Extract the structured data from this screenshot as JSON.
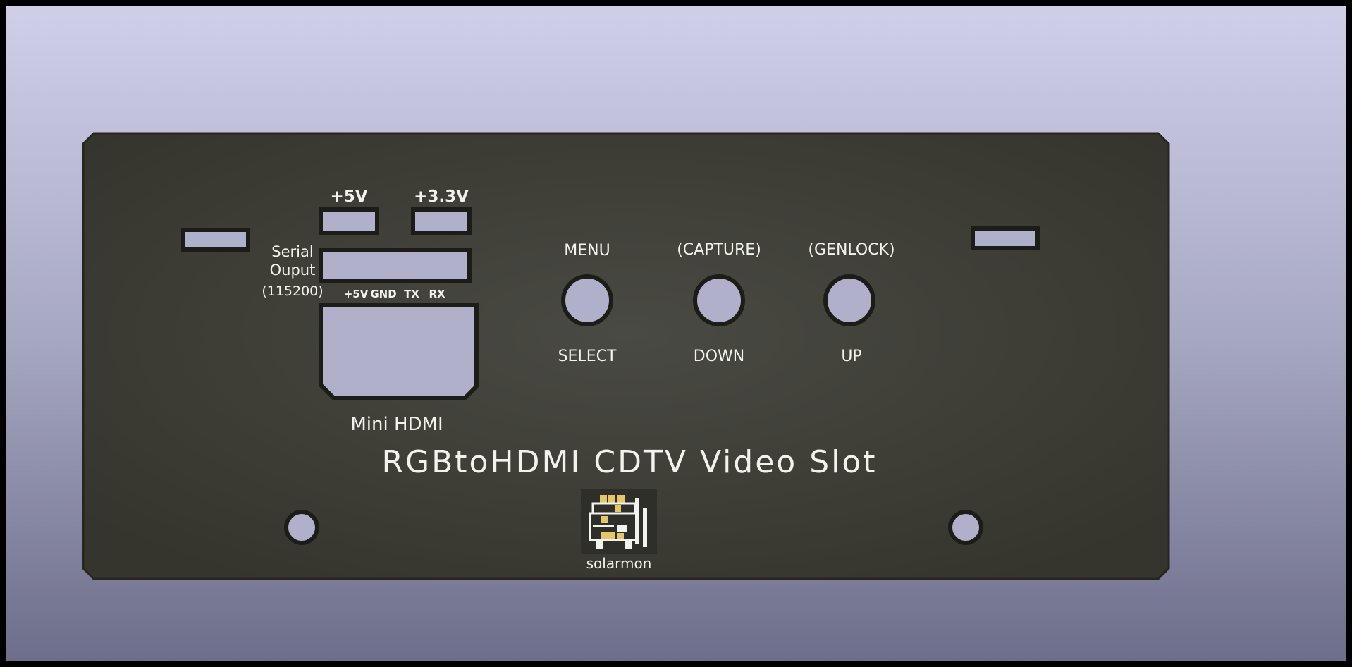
{
  "viewer": {
    "background_top": "#cfcfe8",
    "background_bottom": "#6d6e8a"
  },
  "panel": {
    "board_color": "#3a3a33",
    "cutout_color": "#aeaec8",
    "silkscreen_color": "#f2f2ee",
    "title": "RGBtoHDMI CDTV Video Slot",
    "power": {
      "plus5v": "+5V",
      "plus3v3": "+3.3V"
    },
    "serial": {
      "line1": "Serial",
      "line2": "Ouput",
      "baud": "(115200)",
      "pins": [
        "+5V",
        "GND",
        "TX",
        "RX"
      ]
    },
    "hdmi_label": "Mini HDMI",
    "buttons": [
      {
        "top": "MENU",
        "bottom": "SELECT"
      },
      {
        "top": "(CAPTURE)",
        "bottom": "DOWN"
      },
      {
        "top": "(GENLOCK)",
        "bottom": "UP"
      }
    ],
    "logo": {
      "label": "solarmon",
      "icon": "pixel-art-character-icon"
    }
  }
}
